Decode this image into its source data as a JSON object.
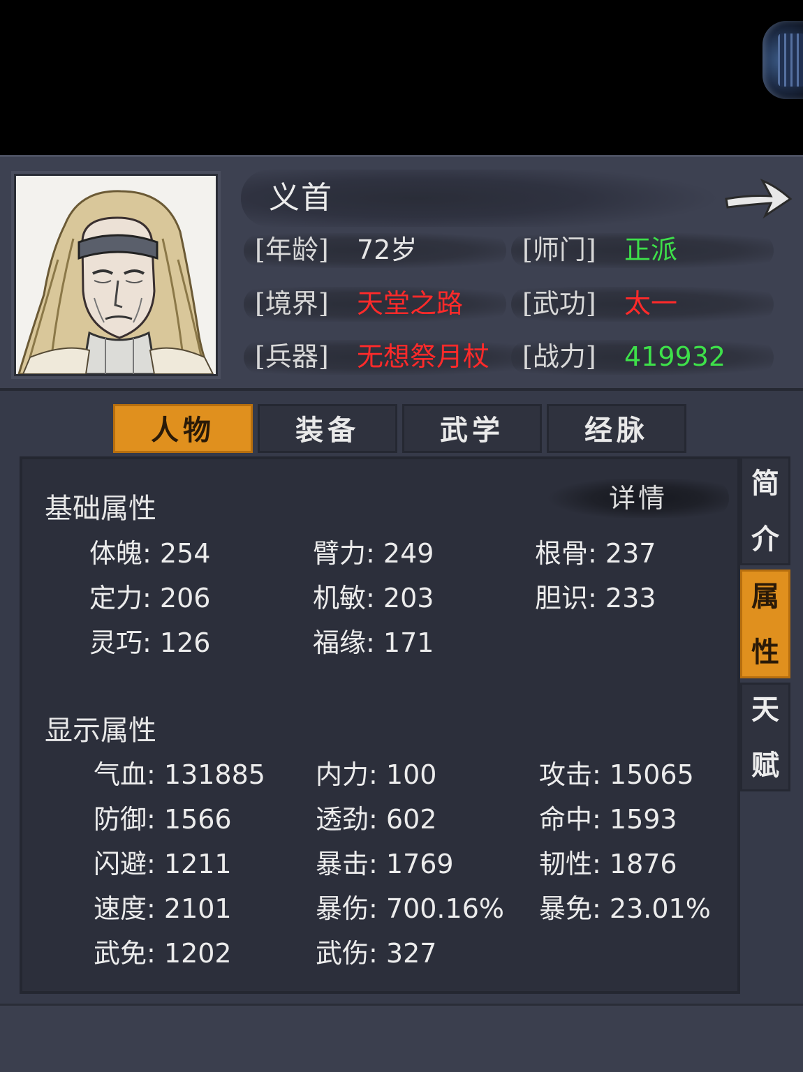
{
  "character": {
    "name": "义首",
    "info": [
      {
        "label": "[年龄]",
        "value": "72岁",
        "color": "#e6e6e6"
      },
      {
        "label": "[师门]",
        "value": "正派",
        "color": "#3ee04a"
      },
      {
        "label": "[境界]",
        "value": "天堂之路",
        "color": "#ff2a2a"
      },
      {
        "label": "[武功]",
        "value": "太一",
        "color": "#ff2a2a"
      },
      {
        "label": "[兵器]",
        "value": "无想祭月杖",
        "color": "#ff2a2a"
      },
      {
        "label": "[战力]",
        "value": "419932",
        "color": "#3ee04a"
      }
    ]
  },
  "tabs": [
    "人物",
    "装备",
    "武学",
    "经脉"
  ],
  "active_tab": "人物",
  "side_tabs": [
    {
      "chars": [
        "简",
        "介"
      ],
      "active": false
    },
    {
      "chars": [
        "属",
        "性"
      ],
      "active": true
    },
    {
      "chars": [
        "天",
        "赋"
      ],
      "active": false
    }
  ],
  "detail_button": "详情",
  "basic_section": {
    "title": "基础属性",
    "stats": [
      {
        "label": "体魄",
        "value": "254"
      },
      {
        "label": "臂力",
        "value": "249"
      },
      {
        "label": "根骨",
        "value": "237"
      },
      {
        "label": "定力",
        "value": "206"
      },
      {
        "label": "机敏",
        "value": "203"
      },
      {
        "label": "胆识",
        "value": "233"
      },
      {
        "label": "灵巧",
        "value": "126"
      },
      {
        "label": "福缘",
        "value": "171"
      }
    ]
  },
  "display_section": {
    "title": "显示属性",
    "stats": [
      {
        "label": "气血",
        "value": "131885"
      },
      {
        "label": "内力",
        "value": "100"
      },
      {
        "label": "攻击",
        "value": "15065"
      },
      {
        "label": "防御",
        "value": "1566"
      },
      {
        "label": "透劲",
        "value": "602"
      },
      {
        "label": "命中",
        "value": "1593"
      },
      {
        "label": "闪避",
        "value": "1211"
      },
      {
        "label": "暴击",
        "value": "1769"
      },
      {
        "label": "韧性",
        "value": "1876"
      },
      {
        "label": "速度",
        "value": "2101"
      },
      {
        "label": "暴伤",
        "value": "700.16%"
      },
      {
        "label": "暴免",
        "value": "23.01%"
      },
      {
        "label": "武免",
        "value": "1202"
      },
      {
        "label": "武伤",
        "value": "327"
      }
    ]
  },
  "colors": {
    "accent": "#e0901e",
    "panel": "#363a49",
    "content": "#2c2f3b"
  }
}
